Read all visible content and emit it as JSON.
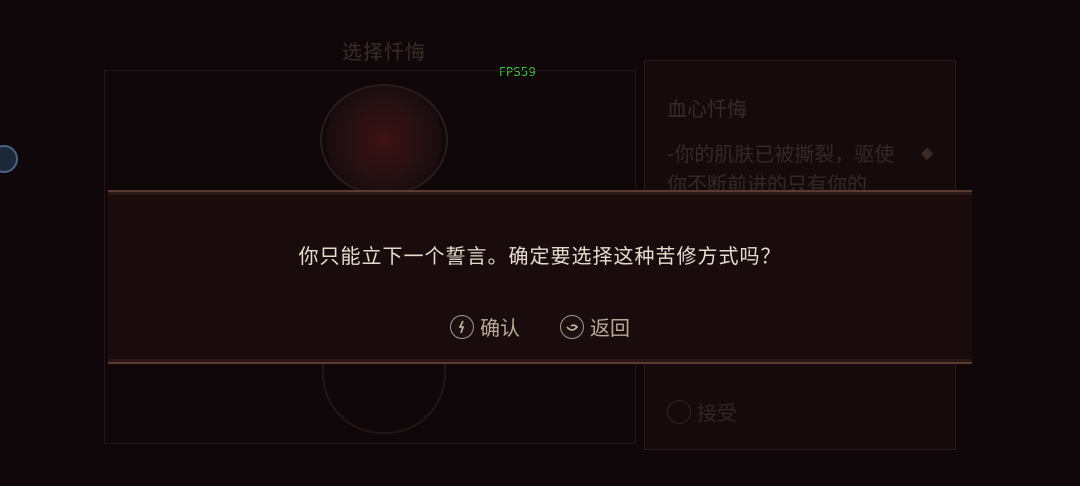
{
  "background": {
    "screen_title": "选择忏悔",
    "fps": "FPS59",
    "panel": {
      "title": "血心忏悔",
      "description": "-你的肌肤已被撕裂，驱使你不断前进的只有你的",
      "partial_line": "",
      "accept_label": "接受"
    }
  },
  "dialog": {
    "message": "你只能立下一个誓言。确定要选择这种苦修方式吗？",
    "confirm_label": "确认",
    "back_label": "返回"
  },
  "colors": {
    "modal_bg": "#1a0b0d",
    "modal_border": "#5a3a31",
    "text": "#e7ddce",
    "fps": "#3fbf3f"
  }
}
